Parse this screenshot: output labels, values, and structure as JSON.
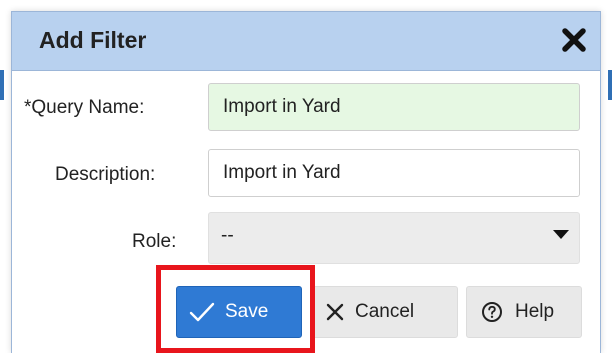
{
  "dialog": {
    "title": "Add Filter"
  },
  "form": {
    "query_name_label": "*Query Name:",
    "query_name_value": "Import in Yard",
    "description_label": "Description:",
    "description_value": "Import in Yard",
    "role_label": "Role:",
    "role_value": "--"
  },
  "buttons": {
    "save_label": "Save",
    "cancel_label": "Cancel",
    "help_label": "Help"
  },
  "colors": {
    "titlebar": "#b8d1ef",
    "save_button": "#2f7ad4",
    "required_field": "#e6f8e3",
    "highlight": "#e8151c"
  }
}
